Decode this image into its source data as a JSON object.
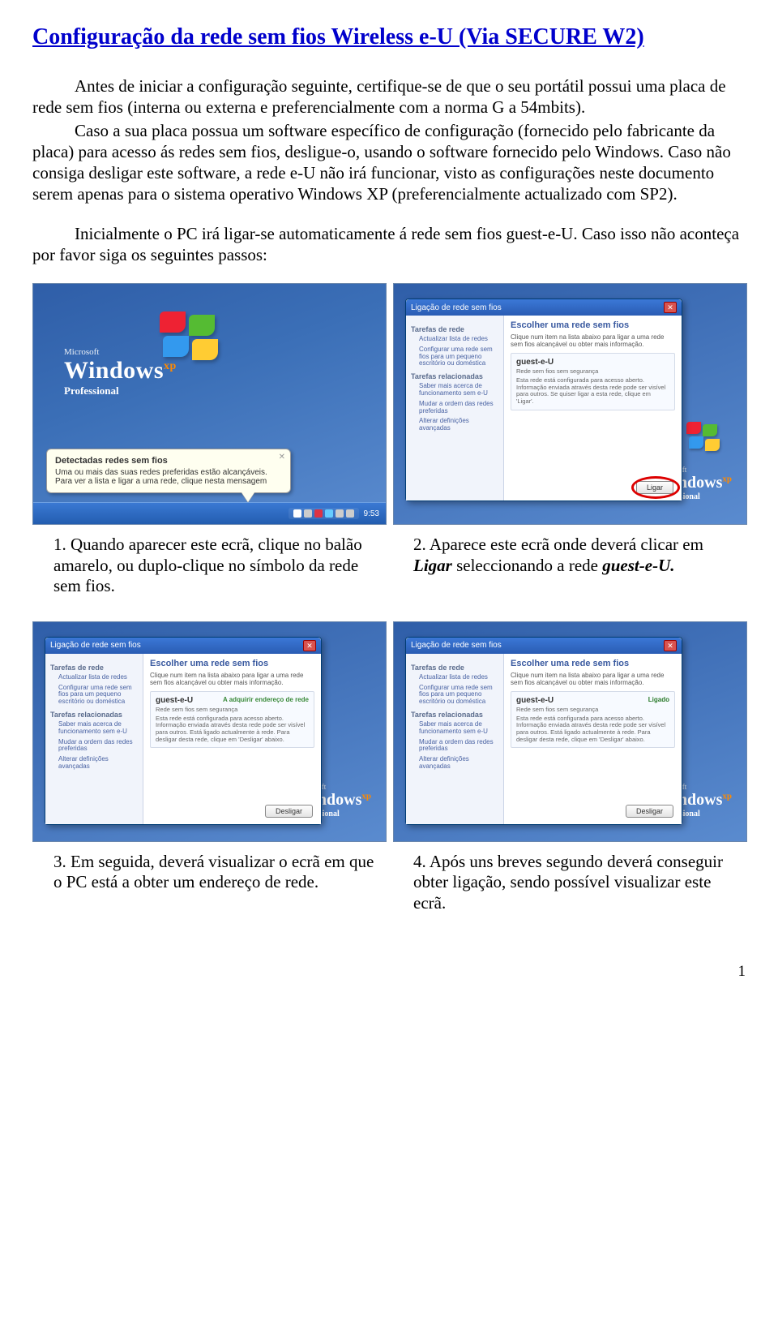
{
  "title": "Configuração da rede sem fios Wireless e-U (Via SECURE W2)",
  "para1": "Antes de iniciar a configuração seguinte, certifique-se de que o seu portátil possui uma placa de rede sem fios (interna ou externa e preferencialmente com a norma G a 54mbits).",
  "para2": "Caso a sua placa possua um software específico de configuração (fornecido pelo fabricante da placa) para acesso ás redes sem fios, desligue-o, usando o software fornecido pelo Windows. Caso não consiga desligar este software, a rede e-U não irá funcionar, visto as configurações neste documento serem apenas para o sistema operativo Windows XP (preferencialmente actualizado com SP2).",
  "para3": "Inicialmente o PC irá ligar-se automaticamente á rede sem fios guest-e-U. Caso isso não aconteça por favor siga os seguintes passos:",
  "shot1": {
    "balloon_title": "Detectadas redes sem fios",
    "balloon_body": "Uma ou mais das suas redes preferidas estão alcançáveis. Para ver a lista e ligar a uma rede, clique nesta mensagem",
    "clock": "9:53",
    "logo_ms": "Microsoft",
    "logo_win": "Windows",
    "logo_xp": "xp",
    "logo_pro": "Professional"
  },
  "wl": {
    "title": "Ligação de rede sem fios",
    "side_h1": "Tarefas de rede",
    "side_l1": "Actualizar lista de redes",
    "side_l2": "Configurar uma rede sem fios para um pequeno escritório ou doméstica",
    "side_h2": "Tarefas relacionadas",
    "side_l3": "Saber mais acerca de funcionamento sem e-U",
    "side_l4": "Mudar a ordem das redes preferidas",
    "side_l5": "Alterar definições avançadas",
    "main_h": "Escolher uma rede sem fios",
    "main_info": "Clique num item na lista abaixo para ligar a uma rede sem fios alcançável ou obter mais informação.",
    "net_name": "guest-e-U",
    "net_sub_open": "Rede sem fios sem segurança",
    "net_desc1": "Esta rede está configurada para acesso aberto. Informação enviada através desta rede pode ser visível para outros. Se quiser ligar a esta rede, clique em 'Ligar'.",
    "status_acq": "A adquirir endereço de rede",
    "net_desc2": "Esta rede está configurada para acesso aberto. Informação enviada através desta rede pode ser visível para outros. Está ligado actualmente à rede. Para desligar desta rede, clique em 'Desligar' abaixo.",
    "status_conn": "Ligado",
    "btn_ligar": "Ligar",
    "btn_desligar": "Desligar"
  },
  "cap1_pre": "1.  Quando aparecer este ecrã, clique no balão amarelo, ou duplo-clique no símbolo da rede sem fios.",
  "cap2_a": "2. Aparece este ecrã onde deverá clicar em ",
  "cap2_b": "Ligar",
  "cap2_c": " seleccionando a rede ",
  "cap2_d": "guest-e-U.",
  "cap3": "3.  Em seguida, deverá visualizar o ecrã em que o PC está a obter um endereço de rede.",
  "cap4": "4.  Após uns breves segundo deverá conseguir obter ligação, sendo possível visualizar este ecrã.",
  "pagenum": "1"
}
